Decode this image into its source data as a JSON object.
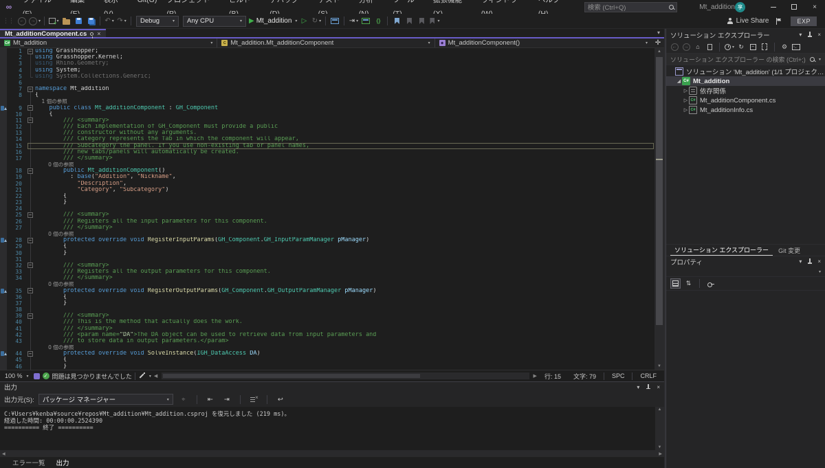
{
  "colors": {
    "accent_purple": "#685cc8",
    "run_green": "#3fae4a",
    "keyword_blue": "#569cd6",
    "type_teal": "#4ec9b0",
    "string_orange": "#d69d85",
    "comment_green": "#5a9e54"
  },
  "titlebar": {
    "menus": [
      "ファイル(F)",
      "編集(E)",
      "表示(V)",
      "Git(G)",
      "プロジェクト(P)",
      "ビルド(B)",
      "デバッグ(D)",
      "テスト(S)",
      "分析(N)",
      "ツール(T)",
      "拡張機能(X)",
      "ウィンドウ(W)",
      "ヘルプ(H)"
    ],
    "search_placeholder": "検索 (Ctrl+Q)",
    "solution_name": "Mt_addition",
    "avatar_text": "享"
  },
  "toolbar": {
    "debug_target": "Debug",
    "platform": "Any CPU",
    "run_target": "Mt_addition",
    "live_share": "Live Share",
    "exp_label": "EXP"
  },
  "editor_tabs": {
    "active_tab": "Mt_additionComponent.cs"
  },
  "breadcrumb": {
    "project": "Mt_addition",
    "type": "Mt_addition.Mt_additionComponent",
    "member": "Mt_additionComponent()"
  },
  "code": {
    "lines": [
      {
        "n": 1,
        "fold": "box",
        "tokens": [
          [
            "k",
            "using "
          ],
          [
            "p",
            "Grasshopper;"
          ]
        ]
      },
      {
        "n": 2,
        "fold": "line",
        "tokens": [
          [
            "k",
            "using "
          ],
          [
            "p",
            "Grasshopper.Kernel;"
          ]
        ]
      },
      {
        "n": 3,
        "fold": "line",
        "dim": true,
        "tokens": [
          [
            "k",
            "using "
          ],
          [
            "p",
            "Rhino.Geometry;"
          ]
        ]
      },
      {
        "n": 4,
        "fold": "line",
        "tokens": [
          [
            "k",
            "using "
          ],
          [
            "p",
            "System;"
          ]
        ]
      },
      {
        "n": 5,
        "fold": "end",
        "dim": true,
        "tokens": [
          [
            "k",
            "using "
          ],
          [
            "p",
            "System.Collections.Generic;"
          ]
        ]
      },
      {
        "n": 6,
        "tokens": []
      },
      {
        "n": 7,
        "fold": "box",
        "tokens": [
          [
            "k",
            "namespace "
          ],
          [
            "p",
            "Mt_addition"
          ]
        ]
      },
      {
        "n": 8,
        "fold": "line",
        "tokens": [
          [
            "p",
            "{"
          ]
        ]
      },
      {
        "n": null,
        "fold": "line",
        "tokens": [
          [
            "cl",
            "    1 個の参照"
          ]
        ]
      },
      {
        "n": 9,
        "fold": "box",
        "margin": true,
        "tokens": [
          [
            "p",
            "    "
          ],
          [
            "k",
            "public class "
          ],
          [
            "t",
            "Mt_additionComponent"
          ],
          [
            "p",
            " : "
          ],
          [
            "t",
            "GH_Component"
          ]
        ]
      },
      {
        "n": 10,
        "fold": "line",
        "tokens": [
          [
            "p",
            "    {"
          ]
        ]
      },
      {
        "n": 11,
        "fold": "box",
        "tokens": [
          [
            "c",
            "        /// <summary>"
          ]
        ]
      },
      {
        "n": 12,
        "fold": "line",
        "tokens": [
          [
            "c",
            "        /// Each implementation of GH_Component must provide a public"
          ]
        ]
      },
      {
        "n": 13,
        "fold": "line",
        "tokens": [
          [
            "c",
            "        /// constructor without any arguments."
          ]
        ]
      },
      {
        "n": 14,
        "fold": "line",
        "tokens": [
          [
            "c",
            "        /// Category represents the Tab in which the component will appear,"
          ]
        ]
      },
      {
        "n": 15,
        "fold": "line",
        "current": true,
        "tokens": [
          [
            "c",
            "        /// Subcategory the panel. If you use non-existing tab or panel names,"
          ]
        ]
      },
      {
        "n": 16,
        "fold": "line",
        "tokens": [
          [
            "c",
            "        /// new tabs/panels will automatically be created."
          ]
        ]
      },
      {
        "n": 17,
        "fold": "line",
        "tokens": [
          [
            "c",
            "        /// </summary>"
          ]
        ]
      },
      {
        "n": null,
        "fold": "line",
        "tokens": [
          [
            "cl",
            "        0 個の参照"
          ]
        ]
      },
      {
        "n": 18,
        "fold": "box",
        "tokens": [
          [
            "p",
            "        "
          ],
          [
            "k",
            "public "
          ],
          [
            "t",
            "Mt_additionComponent"
          ],
          [
            "p",
            "()"
          ]
        ]
      },
      {
        "n": 19,
        "fold": "line",
        "tokens": [
          [
            "p",
            "          : "
          ],
          [
            "k",
            "base"
          ],
          [
            "p",
            "("
          ],
          [
            "s",
            "\"Addition\""
          ],
          [
            "p",
            ", "
          ],
          [
            "s",
            "\"Nickname\""
          ],
          [
            "p",
            ","
          ]
        ]
      },
      {
        "n": 20,
        "fold": "line",
        "tokens": [
          [
            "p",
            "            "
          ],
          [
            "s",
            "\"Description\""
          ],
          [
            "p",
            ","
          ]
        ]
      },
      {
        "n": 21,
        "fold": "line",
        "tokens": [
          [
            "p",
            "            "
          ],
          [
            "s",
            "\"Category\""
          ],
          [
            "p",
            ", "
          ],
          [
            "s",
            "\"Subcategory\""
          ],
          [
            "p",
            ")"
          ]
        ]
      },
      {
        "n": 22,
        "fold": "line",
        "tokens": [
          [
            "p",
            "        {"
          ]
        ]
      },
      {
        "n": 23,
        "fold": "line",
        "tokens": [
          [
            "p",
            "        }"
          ]
        ]
      },
      {
        "n": 24,
        "fold": "line",
        "tokens": []
      },
      {
        "n": 25,
        "fold": "box",
        "tokens": [
          [
            "c",
            "        /// <summary>"
          ]
        ]
      },
      {
        "n": 26,
        "fold": "line",
        "tokens": [
          [
            "c",
            "        /// Registers all the input parameters for this component."
          ]
        ]
      },
      {
        "n": 27,
        "fold": "line",
        "tokens": [
          [
            "c",
            "        /// </summary>"
          ]
        ]
      },
      {
        "n": null,
        "fold": "line",
        "tokens": [
          [
            "cl",
            "        0 個の参照"
          ]
        ]
      },
      {
        "n": 28,
        "fold": "box",
        "margin": true,
        "tokens": [
          [
            "p",
            "        "
          ],
          [
            "k",
            "protected override void "
          ],
          [
            "m",
            "RegisterInputParams"
          ],
          [
            "p",
            "("
          ],
          [
            "t",
            "GH_Component"
          ],
          [
            "p",
            "."
          ],
          [
            "t",
            "GH_InputParamManager"
          ],
          [
            "pm",
            " pManager"
          ],
          [
            "p",
            ")"
          ]
        ]
      },
      {
        "n": 29,
        "fold": "line",
        "tokens": [
          [
            "p",
            "        {"
          ]
        ]
      },
      {
        "n": 30,
        "fold": "line",
        "tokens": [
          [
            "p",
            "        }"
          ]
        ]
      },
      {
        "n": 31,
        "fold": "line",
        "tokens": []
      },
      {
        "n": 32,
        "fold": "box",
        "tokens": [
          [
            "c",
            "        /// <summary>"
          ]
        ]
      },
      {
        "n": 33,
        "fold": "line",
        "tokens": [
          [
            "c",
            "        /// Registers all the output parameters for this component."
          ]
        ]
      },
      {
        "n": 34,
        "fold": "line",
        "tokens": [
          [
            "c",
            "        /// </summary>"
          ]
        ]
      },
      {
        "n": null,
        "fold": "line",
        "tokens": [
          [
            "cl",
            "        0 個の参照"
          ]
        ]
      },
      {
        "n": 35,
        "fold": "box",
        "margin": true,
        "tokens": [
          [
            "p",
            "        "
          ],
          [
            "k",
            "protected override void "
          ],
          [
            "m",
            "RegisterOutputParams"
          ],
          [
            "p",
            "("
          ],
          [
            "t",
            "GH_Component"
          ],
          [
            "p",
            "."
          ],
          [
            "t",
            "GH_OutputParamManager"
          ],
          [
            "pm",
            " pManager"
          ],
          [
            "p",
            ")"
          ]
        ]
      },
      {
        "n": 36,
        "fold": "line",
        "tokens": [
          [
            "p",
            "        {"
          ]
        ]
      },
      {
        "n": 37,
        "fold": "line",
        "tokens": [
          [
            "p",
            "        }"
          ]
        ]
      },
      {
        "n": 38,
        "fold": "line",
        "tokens": []
      },
      {
        "n": 39,
        "fold": "box",
        "tokens": [
          [
            "c",
            "        /// <summary>"
          ]
        ]
      },
      {
        "n": 40,
        "fold": "line",
        "tokens": [
          [
            "c",
            "        /// This is the method that actually does the work."
          ]
        ]
      },
      {
        "n": 41,
        "fold": "line",
        "tokens": [
          [
            "c",
            "        /// </summary>"
          ]
        ]
      },
      {
        "n": 42,
        "fold": "line",
        "tokens": [
          [
            "c",
            "        /// <param name="
          ],
          [
            "ca",
            "\"DA\""
          ],
          [
            "c",
            ">The DA object can be used to retrieve data from input parameters and"
          ]
        ]
      },
      {
        "n": 43,
        "fold": "line",
        "tokens": [
          [
            "c",
            "        /// to store data in output parameters.</param>"
          ]
        ]
      },
      {
        "n": null,
        "fold": "line",
        "tokens": [
          [
            "cl",
            "        0 個の参照"
          ]
        ]
      },
      {
        "n": 44,
        "fold": "box",
        "margin": true,
        "tokens": [
          [
            "p",
            "        "
          ],
          [
            "k",
            "protected override void "
          ],
          [
            "m",
            "SolveInstance"
          ],
          [
            "p",
            "("
          ],
          [
            "t",
            "IGH_DataAccess"
          ],
          [
            "pm",
            " DA"
          ],
          [
            "p",
            ")"
          ]
        ]
      },
      {
        "n": 45,
        "fold": "line",
        "tokens": [
          [
            "p",
            "        {"
          ]
        ]
      },
      {
        "n": 46,
        "fold": "line",
        "tokens": [
          [
            "p",
            "        }"
          ]
        ]
      },
      {
        "n": 47,
        "fold": "line",
        "tokens": []
      }
    ]
  },
  "editor_status": {
    "zoom": "100 %",
    "message": "問題は見つかりませんでした",
    "line_label": "行: 15",
    "col_label": "文字: 79",
    "encoding": "SPC",
    "line_ending": "CRLF"
  },
  "output": {
    "title": "出力",
    "source_label": "出力元(S):",
    "source_value": "パッケージ マネージャー",
    "lines": [
      "C:¥Users¥kenba¥source¥repos¥Mt_addition¥Mt_addition.csproj を復元しました (219 ms)。",
      "経過した時間: 00:00:00.2524390",
      "========== 終了 =========="
    ]
  },
  "bottom_tabs": [
    {
      "label": "エラー一覧",
      "active": false
    },
    {
      "label": "出力",
      "active": true
    }
  ],
  "solution_explorer": {
    "title": "ソリューション エクスプローラー",
    "search_placeholder": "ソリューション エクスプローラー の検索 (Ctrl+;)",
    "tree": [
      {
        "label": "ソリューション 'Mt_addition' (1/1 プロジェクト)",
        "icon": "solution",
        "indent": 0,
        "expander": "none"
      },
      {
        "label": "Mt_addition",
        "icon": "csproject",
        "indent": 1,
        "expander": "expanded",
        "selected": true,
        "bold": true
      },
      {
        "label": "依存関係",
        "icon": "dependencies",
        "indent": 2,
        "expander": "collapsed"
      },
      {
        "label": "Mt_additionComponent.cs",
        "icon": "csfile",
        "indent": 2,
        "expander": "collapsed"
      },
      {
        "label": "Mt_additionInfo.cs",
        "icon": "csfile",
        "indent": 2,
        "expander": "collapsed"
      }
    ]
  },
  "side_tabs": [
    {
      "label": "ソリューション エクスプローラー",
      "active": true
    },
    {
      "label": "Git 変更",
      "active": false
    }
  ],
  "properties": {
    "title": "プロパティ"
  }
}
